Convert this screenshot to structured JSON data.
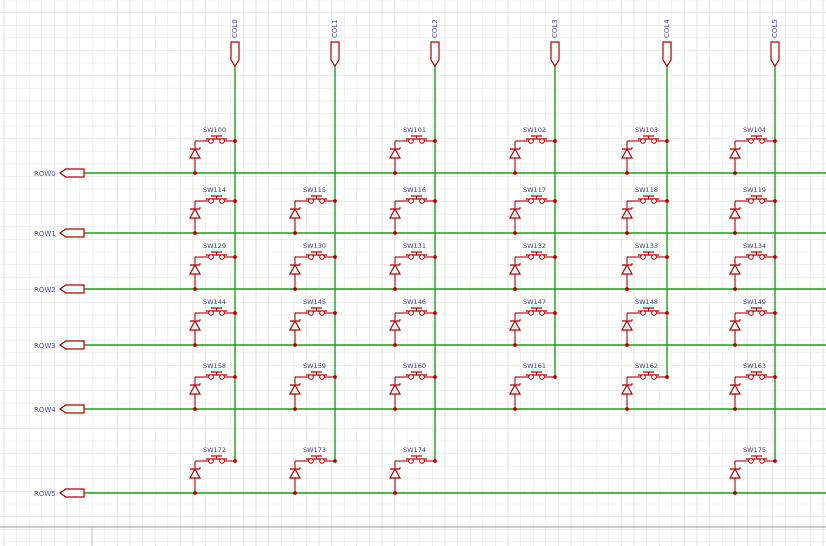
{
  "colors": {
    "background": "#ffffff",
    "grid": "#e6e6e6",
    "grid_major": "#cfcfcf",
    "wire": "#1e9e1e",
    "component": "#b30000",
    "label": "#4b4bb4",
    "ref_text": "#3c3c6e"
  },
  "columns": [
    {
      "label": "COL0"
    },
    {
      "label": "COL1"
    },
    {
      "label": "COL2"
    },
    {
      "label": "COL3"
    },
    {
      "label": "COL4"
    },
    {
      "label": "COL5"
    }
  ],
  "rows": [
    {
      "label": "ROW0"
    },
    {
      "label": "ROW1"
    },
    {
      "label": "ROW2"
    },
    {
      "label": "ROW3"
    },
    {
      "label": "ROW4"
    },
    {
      "label": "ROW5"
    }
  ],
  "switches": [
    {
      "ref": "SW100",
      "row": 0,
      "col": 0
    },
    {
      "ref": "SW101",
      "row": 0,
      "col": 2
    },
    {
      "ref": "SW102",
      "row": 0,
      "col": 3
    },
    {
      "ref": "SW103",
      "row": 0,
      "col": 4
    },
    {
      "ref": "SW104",
      "row": 0,
      "col": 5
    },
    {
      "ref": "SW114",
      "row": 1,
      "col": 0
    },
    {
      "ref": "SW115",
      "row": 1,
      "col": 1
    },
    {
      "ref": "SW116",
      "row": 1,
      "col": 2
    },
    {
      "ref": "SW117",
      "row": 1,
      "col": 3
    },
    {
      "ref": "SW118",
      "row": 1,
      "col": 4
    },
    {
      "ref": "SW119",
      "row": 1,
      "col": 5
    },
    {
      "ref": "SW129",
      "row": 2,
      "col": 0
    },
    {
      "ref": "SW130",
      "row": 2,
      "col": 1
    },
    {
      "ref": "SW131",
      "row": 2,
      "col": 2
    },
    {
      "ref": "SW132",
      "row": 2,
      "col": 3
    },
    {
      "ref": "SW133",
      "row": 2,
      "col": 4
    },
    {
      "ref": "SW134",
      "row": 2,
      "col": 5
    },
    {
      "ref": "SW144",
      "row": 3,
      "col": 0
    },
    {
      "ref": "SW145",
      "row": 3,
      "col": 1
    },
    {
      "ref": "SW146",
      "row": 3,
      "col": 2
    },
    {
      "ref": "SW147",
      "row": 3,
      "col": 3
    },
    {
      "ref": "SW148",
      "row": 3,
      "col": 4
    },
    {
      "ref": "SW149",
      "row": 3,
      "col": 5
    },
    {
      "ref": "SW158",
      "row": 4,
      "col": 0
    },
    {
      "ref": "SW159",
      "row": 4,
      "col": 1
    },
    {
      "ref": "SW160",
      "row": 4,
      "col": 2
    },
    {
      "ref": "SW161",
      "row": 4,
      "col": 3
    },
    {
      "ref": "SW162",
      "row": 4,
      "col": 4
    },
    {
      "ref": "SW163",
      "row": 4,
      "col": 5
    },
    {
      "ref": "SW172",
      "row": 5,
      "col": 0
    },
    {
      "ref": "SW173",
      "row": 5,
      "col": 1
    },
    {
      "ref": "SW174",
      "row": 5,
      "col": 2
    },
    {
      "ref": "SW175",
      "row": 5,
      "col": 5
    }
  ]
}
